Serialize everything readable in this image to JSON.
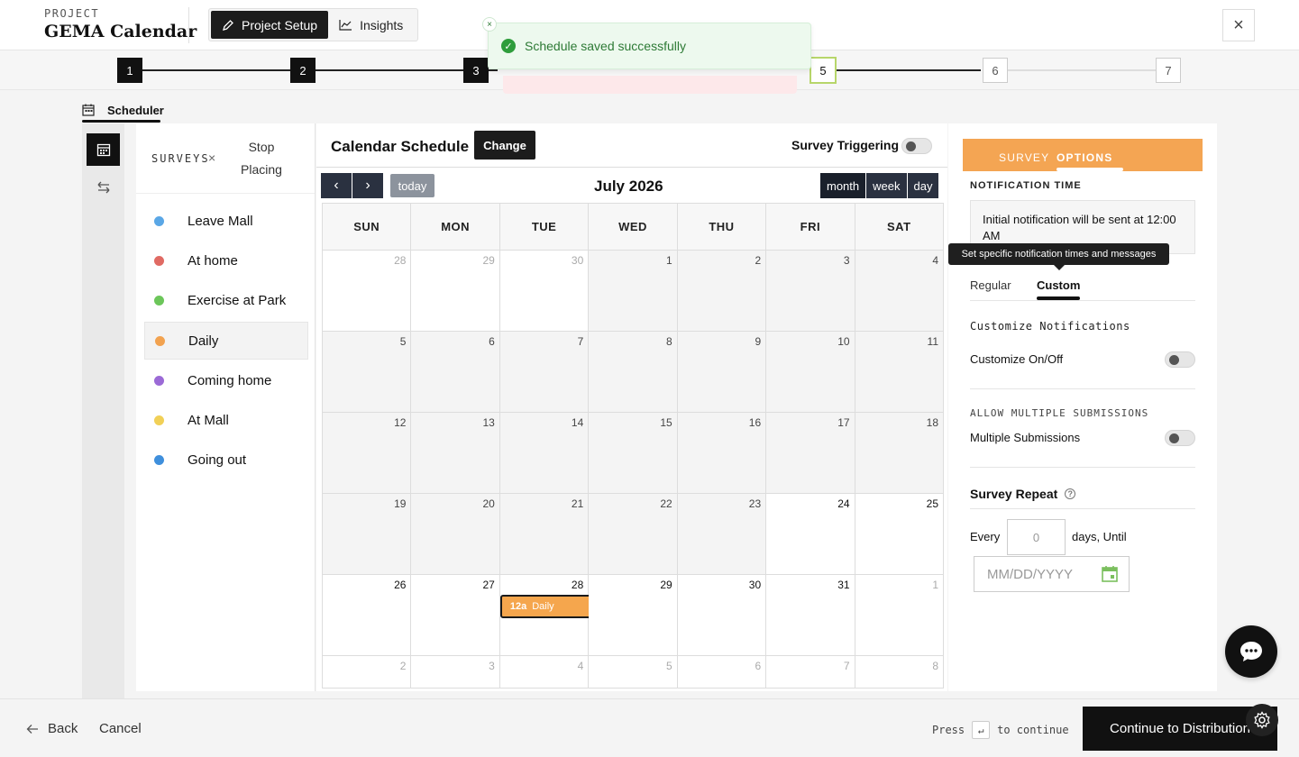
{
  "header": {
    "project_label": "PROJECT",
    "project_name": "GEMA Calendar",
    "tabs": [
      {
        "label": "Project Setup",
        "active": true,
        "icon": "pencil-icon"
      },
      {
        "label": "Insights",
        "active": false,
        "icon": "chart-line-icon"
      }
    ],
    "close_icon": "close-icon"
  },
  "stepper": {
    "steps": [
      "1",
      "2",
      "3",
      "4",
      "5",
      "6",
      "7"
    ],
    "current": 5
  },
  "toast": {
    "message": "Schedule saved successfully",
    "icon": "check-circle-icon",
    "color": "#2f9d3c"
  },
  "scheduler_tab": {
    "label": "Scheduler",
    "icon": "calendar-icon"
  },
  "surveys": {
    "title": "SURVEYS",
    "stop_placing": "Stop Placing",
    "items": [
      {
        "label": "Leave Mall",
        "color": "#5aa7e6",
        "selected": false
      },
      {
        "label": "At home",
        "color": "#e06a63",
        "selected": false
      },
      {
        "label": "Exercise at Park",
        "color": "#6cc65a",
        "selected": false
      },
      {
        "label": "Daily",
        "color": "#f2a24f",
        "selected": true
      },
      {
        "label": "Coming home",
        "color": "#9b6ad6",
        "selected": false
      },
      {
        "label": "At Mall",
        "color": "#f1d057",
        "selected": false
      },
      {
        "label": "Going out",
        "color": "#3f8fdc",
        "selected": false
      }
    ]
  },
  "calendar": {
    "title": "Calendar Schedule",
    "change_label": "Change",
    "survey_triggering_label": "Survey Triggering",
    "today_label": "today",
    "month_title": "July 2026",
    "views": [
      {
        "label": "month",
        "active": true
      },
      {
        "label": "week",
        "active": false
      },
      {
        "label": "day",
        "active": false
      }
    ],
    "dow": [
      "SUN",
      "MON",
      "TUE",
      "WED",
      "THU",
      "FRI",
      "SAT"
    ],
    "weeks": [
      [
        [
          "28",
          "other"
        ],
        [
          "29",
          "other"
        ],
        [
          "30",
          "other"
        ],
        [
          "1",
          "past"
        ],
        [
          "2",
          "past"
        ],
        [
          "3",
          "past"
        ],
        [
          "4",
          "past"
        ]
      ],
      [
        [
          "5",
          "past"
        ],
        [
          "6",
          "past"
        ],
        [
          "7",
          "past"
        ],
        [
          "8",
          "past"
        ],
        [
          "9",
          "past"
        ],
        [
          "10",
          "past"
        ],
        [
          "11",
          "past"
        ]
      ],
      [
        [
          "12",
          "past"
        ],
        [
          "13",
          "past"
        ],
        [
          "14",
          "past"
        ],
        [
          "15",
          "past"
        ],
        [
          "16",
          "past"
        ],
        [
          "17",
          "past"
        ],
        [
          "18",
          "past"
        ]
      ],
      [
        [
          "19",
          "past"
        ],
        [
          "20",
          "past"
        ],
        [
          "21",
          "past"
        ],
        [
          "22",
          "past"
        ],
        [
          "23",
          "past"
        ],
        [
          "24",
          "future"
        ],
        [
          "25",
          "future"
        ]
      ],
      [
        [
          "26",
          "future"
        ],
        [
          "27",
          "future"
        ],
        [
          "28",
          "future"
        ],
        [
          "29",
          "future"
        ],
        [
          "30",
          "future"
        ],
        [
          "31",
          "future"
        ],
        [
          "1",
          "other"
        ]
      ],
      [
        [
          "2",
          "other"
        ],
        [
          "3",
          "other"
        ],
        [
          "4",
          "other"
        ],
        [
          "5",
          "other"
        ],
        [
          "6",
          "other"
        ],
        [
          "7",
          "other"
        ],
        [
          "8",
          "other"
        ]
      ]
    ],
    "event": {
      "time": "12a",
      "label": "Daily",
      "week": 4,
      "day": 2,
      "color": "#f5a64d"
    }
  },
  "options": {
    "tabs": [
      {
        "label": "SURVEY",
        "active": false
      },
      {
        "label": "OPTIONS",
        "active": true
      }
    ],
    "notification_time_label": "NOTIFICATION TIME",
    "notification_text": "Initial notification will be sent at 12:00 AM",
    "tooltip": "Set specific notification times and messages",
    "subtabs": [
      {
        "label": "Regular",
        "active": false
      },
      {
        "label": "Custom",
        "active": true
      }
    ],
    "customize_heading": "Customize Notifications",
    "customize_toggle_label": "Customize On/Off",
    "allow_multiple_heading": "ALLOW MULTIPLE SUBMISSIONS",
    "multiple_toggle_label": "Multiple Submissions",
    "survey_repeat_title": "Survey Repeat",
    "every_label": "Every",
    "every_placeholder": "0",
    "days_until_label": "days, Until",
    "date_placeholder": "MM/DD/YYYY"
  },
  "footer": {
    "back_label": "Back",
    "cancel_label": "Cancel",
    "press_label": "Press",
    "enter_key": "↵",
    "to_continue_label": "to continue",
    "continue_label": "Continue to Distribution"
  }
}
